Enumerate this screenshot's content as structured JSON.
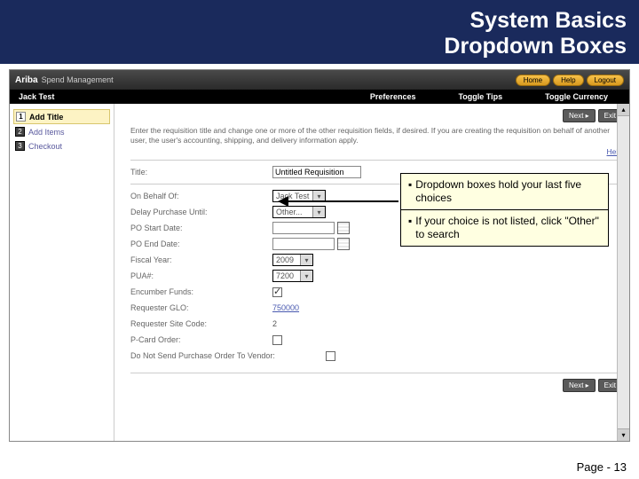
{
  "slide": {
    "title_line1": "System Basics",
    "title_line2": "Dropdown  Boxes",
    "page_label": "Page - 13"
  },
  "app": {
    "brand": "Ariba",
    "brand_sub": "Spend Management",
    "header_buttons": {
      "home": "Home",
      "help": "Help",
      "logout": "Logout"
    },
    "tabs": {
      "user": "Jack Test",
      "preferences": "Preferences",
      "toggle_tips": "Toggle Tips",
      "toggle_currency": "Toggle Currency"
    },
    "actions": {
      "next": "Next ▸",
      "exit": "Exit"
    }
  },
  "sidebar": {
    "items": [
      {
        "num": "1",
        "label": "Add Title"
      },
      {
        "num": "2",
        "label": "Add Items"
      },
      {
        "num": "3",
        "label": "Checkout"
      }
    ]
  },
  "intro_text": "Enter the requisition title and change one or more of the other requisition fields, if desired. If you are creating the requisition on behalf of another user, the user's accounting, shipping, and delivery information apply.",
  "help_link": "Help",
  "form": {
    "title_label": "Title:",
    "title_value": "Untitled Requisition",
    "behalf_label": "On Behalf Of:",
    "behalf_value": "Jack Test",
    "delay_label": "Delay Purchase Until:",
    "delay_value": "Other...",
    "po_start_label": "PO Start Date:",
    "po_end_label": "PO End Date:",
    "fiscal_year_label": "Fiscal Year:",
    "fiscal_year_value": "2009",
    "pua_label": "PUA#:",
    "pua_value": "7200",
    "encumber_label": "Encumber Funds:",
    "req_glo_label": "Requester GLO:",
    "req_glo_value": "750000",
    "site_code_label": "Requester Site Code:",
    "site_code_value": "2",
    "pcard_label": "P-Card Order:",
    "nosend_label": "Do Not Send Purchase Order To Vendor:"
  },
  "callout": {
    "bullet": "▪",
    "line1": "Dropdown boxes hold your last five choices",
    "line2": "If your choice is not listed, click \"Other\" to search"
  }
}
